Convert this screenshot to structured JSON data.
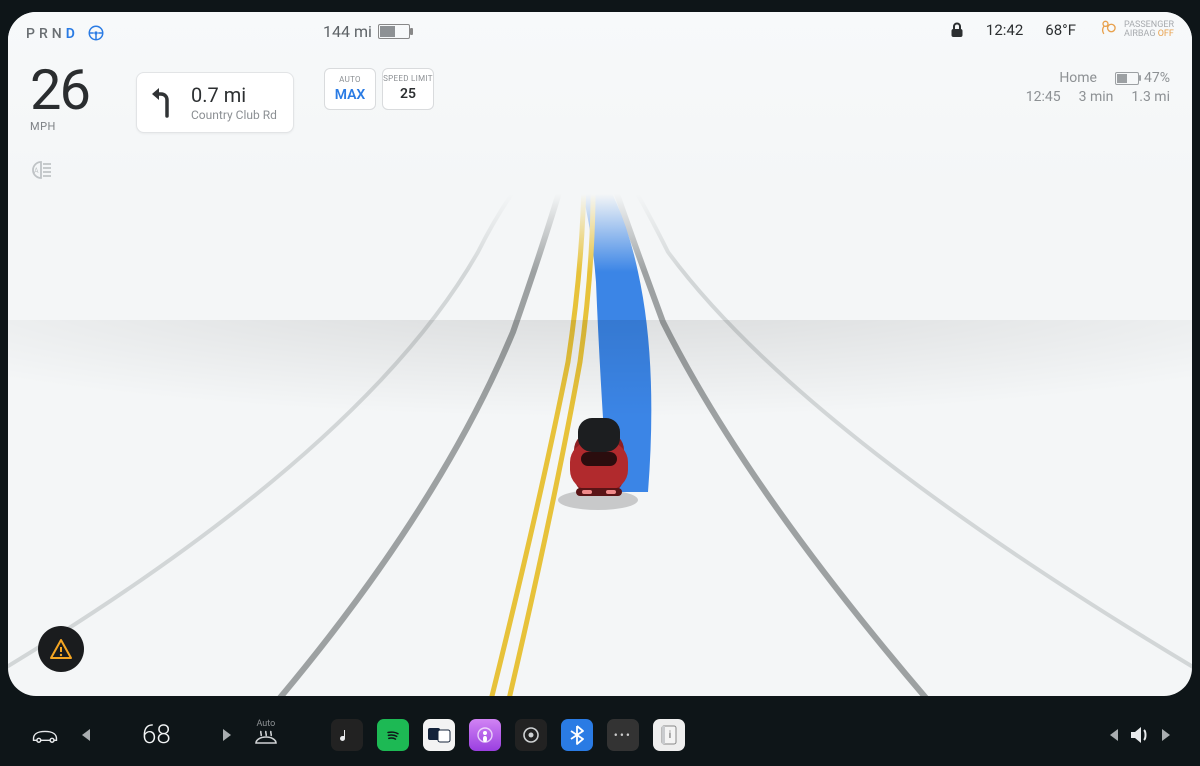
{
  "gear": {
    "p": "P",
    "r": "R",
    "n": "N",
    "d": "D"
  },
  "range": {
    "miles": "144 mi",
    "battery_pct": 52
  },
  "clock": "12:42",
  "temp_ext": "68°F",
  "airbag": {
    "label": "PASSENGER",
    "sub": "AIRBAG",
    "state": "OFF"
  },
  "speed": {
    "value": "26",
    "unit": "MPH"
  },
  "nav": {
    "distance": "0.7 mi",
    "road": "Country Club Rd"
  },
  "limits": {
    "auto_label": "AUTO",
    "auto_value": "MAX",
    "speed_label": "SPEED LIMIT",
    "speed_value": "25"
  },
  "dest": {
    "name": "Home",
    "soc": "47%",
    "eta": "12:45",
    "duration": "3 min",
    "distance": "1.3 mi"
  },
  "dock": {
    "cabin_temp": "68",
    "defrost_mode": "Auto"
  }
}
